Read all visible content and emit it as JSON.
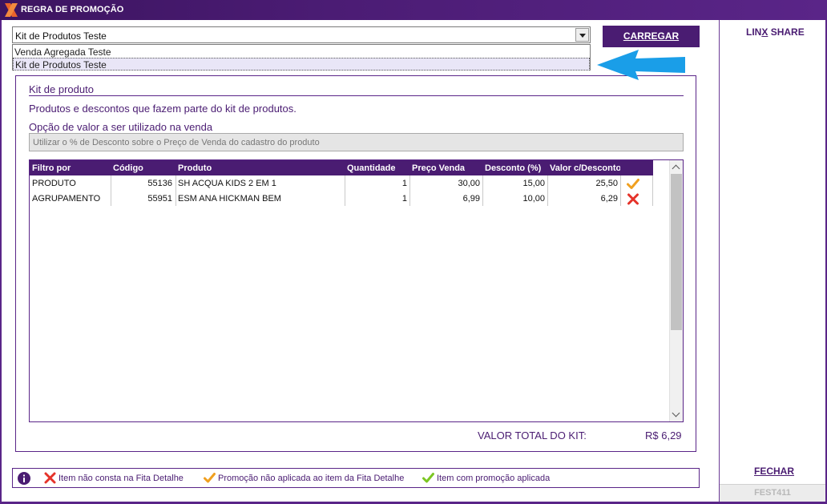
{
  "window": {
    "title": "REGRA DE PROMOÇÃO"
  },
  "rule_selector": {
    "selected": "Kit de Produtos Teste",
    "options": [
      "Venda Agregada Teste",
      "Kit de Produtos Teste"
    ],
    "highlighted_index": 1
  },
  "toolbar": {
    "load_label": "CARREGAR",
    "linx_share_pre": "LIN",
    "linx_share_key": "X",
    "linx_share_post": " SHARE",
    "close_label": "FECHAR",
    "terminal_code": "FEST411"
  },
  "kit": {
    "heading": "Kit de produto",
    "description": "Produtos e descontos que fazem parte do kit de produtos.",
    "value_option_label": "Opção de valor a ser utilizado na venda",
    "value_option": "Utilizar o % de Desconto sobre o Preço de Venda do cadastro do produto"
  },
  "table": {
    "columns": [
      "Filtro por",
      "Código",
      "Produto",
      "Quantidade",
      "Preço Venda",
      "Desconto (%)",
      "Valor c/Desconto"
    ],
    "rows": [
      {
        "filtro": "PRODUTO",
        "codigo": "55136",
        "produto": "SH ACQUA KIDS 2 EM 1",
        "quantidade": "1",
        "preco": "30,00",
        "desconto": "15,00",
        "valor": "25,50",
        "status": "check-orange"
      },
      {
        "filtro": "AGRUPAMENTO",
        "codigo": "55951",
        "produto": "ESM ANA HICKMAN BEM",
        "quantidade": "1",
        "preco": "6,99",
        "desconto": "10,00",
        "valor": "6,29",
        "status": "x-red"
      }
    ]
  },
  "total": {
    "label": "VALOR TOTAL DO KIT:",
    "value": "R$ 6,29"
  },
  "legend": {
    "items": [
      {
        "icon": "x-red",
        "text": "Item não consta na Fita Detalhe"
      },
      {
        "icon": "check-orange",
        "text": "Promoção não aplicada ao item da Fita Detalhe"
      },
      {
        "icon": "check-green",
        "text": "Item com promoção aplicada"
      }
    ]
  },
  "colors": {
    "brand_purple": "#4a1c72",
    "accent_blue": "#1a9ee8",
    "error_red": "#e5332a",
    "warning_orange": "#f0a020",
    "success_green": "#7cc623"
  }
}
